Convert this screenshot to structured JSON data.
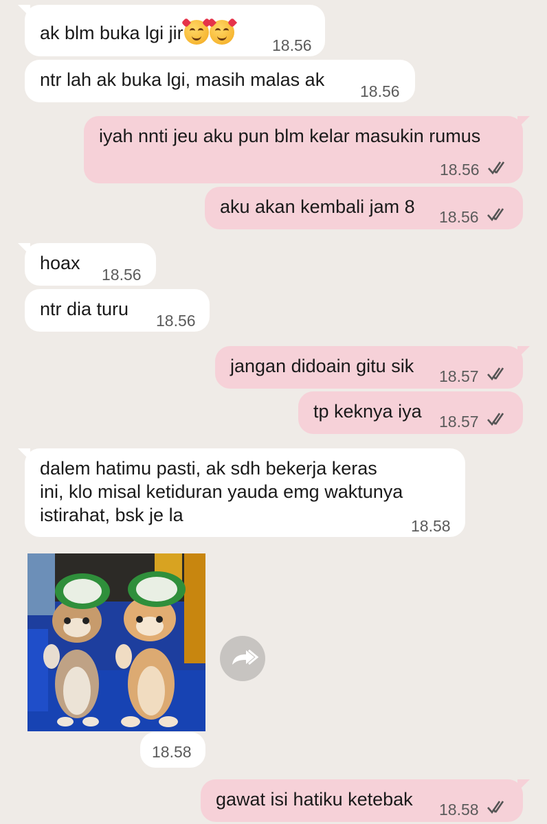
{
  "messages": [
    {
      "text": "ak blm buka lgi jir",
      "emojis": [
        "smiling-face-with-hearts",
        "smiling-face-with-hearts"
      ],
      "time": "18.56",
      "direction": "in"
    },
    {
      "text": "ntr lah ak buka lgi, masih malas ak",
      "time": "18.56",
      "direction": "in"
    },
    {
      "text": "iyah nnti jeu aku pun blm kelar masukin rumus",
      "time": "18.56",
      "direction": "out",
      "status": "read"
    },
    {
      "text": "aku akan kembali jam 8",
      "time": "18.56",
      "direction": "out",
      "status": "read"
    },
    {
      "text": "hoax",
      "time": "18.56",
      "direction": "in"
    },
    {
      "text": "ntr dia turu",
      "time": "18.56",
      "direction": "in"
    },
    {
      "text": "jangan didoain gitu sik",
      "time": "18.57",
      "direction": "out",
      "status": "read"
    },
    {
      "text": "tp keknya iya",
      "time": "18.57",
      "direction": "out",
      "status": "read"
    },
    {
      "lines": [
        "dalem hatimu pasti, ak sdh bekerja keras",
        "ini, klo misal ketiduran yauda emg waktunya",
        "istirahat, bsk je la"
      ],
      "time": "18.58",
      "direction": "in"
    },
    {
      "image": "sticker-two-kittens-wearing-green-hats",
      "time": "18.58",
      "direction": "in"
    },
    {
      "text": "gawat isi hatiku ketebak",
      "time": "18.58",
      "direction": "out",
      "status": "read"
    }
  ],
  "colors": {
    "background": "#efebe7",
    "incoming_bubble": "#ffffff",
    "outgoing_bubble": "#f6d1d8",
    "timestamp": "#5b5b5b",
    "forward_button": "#c7c4c1"
  },
  "icons": {
    "read_receipt": "double-check-icon",
    "forward": "forward-icon"
  }
}
